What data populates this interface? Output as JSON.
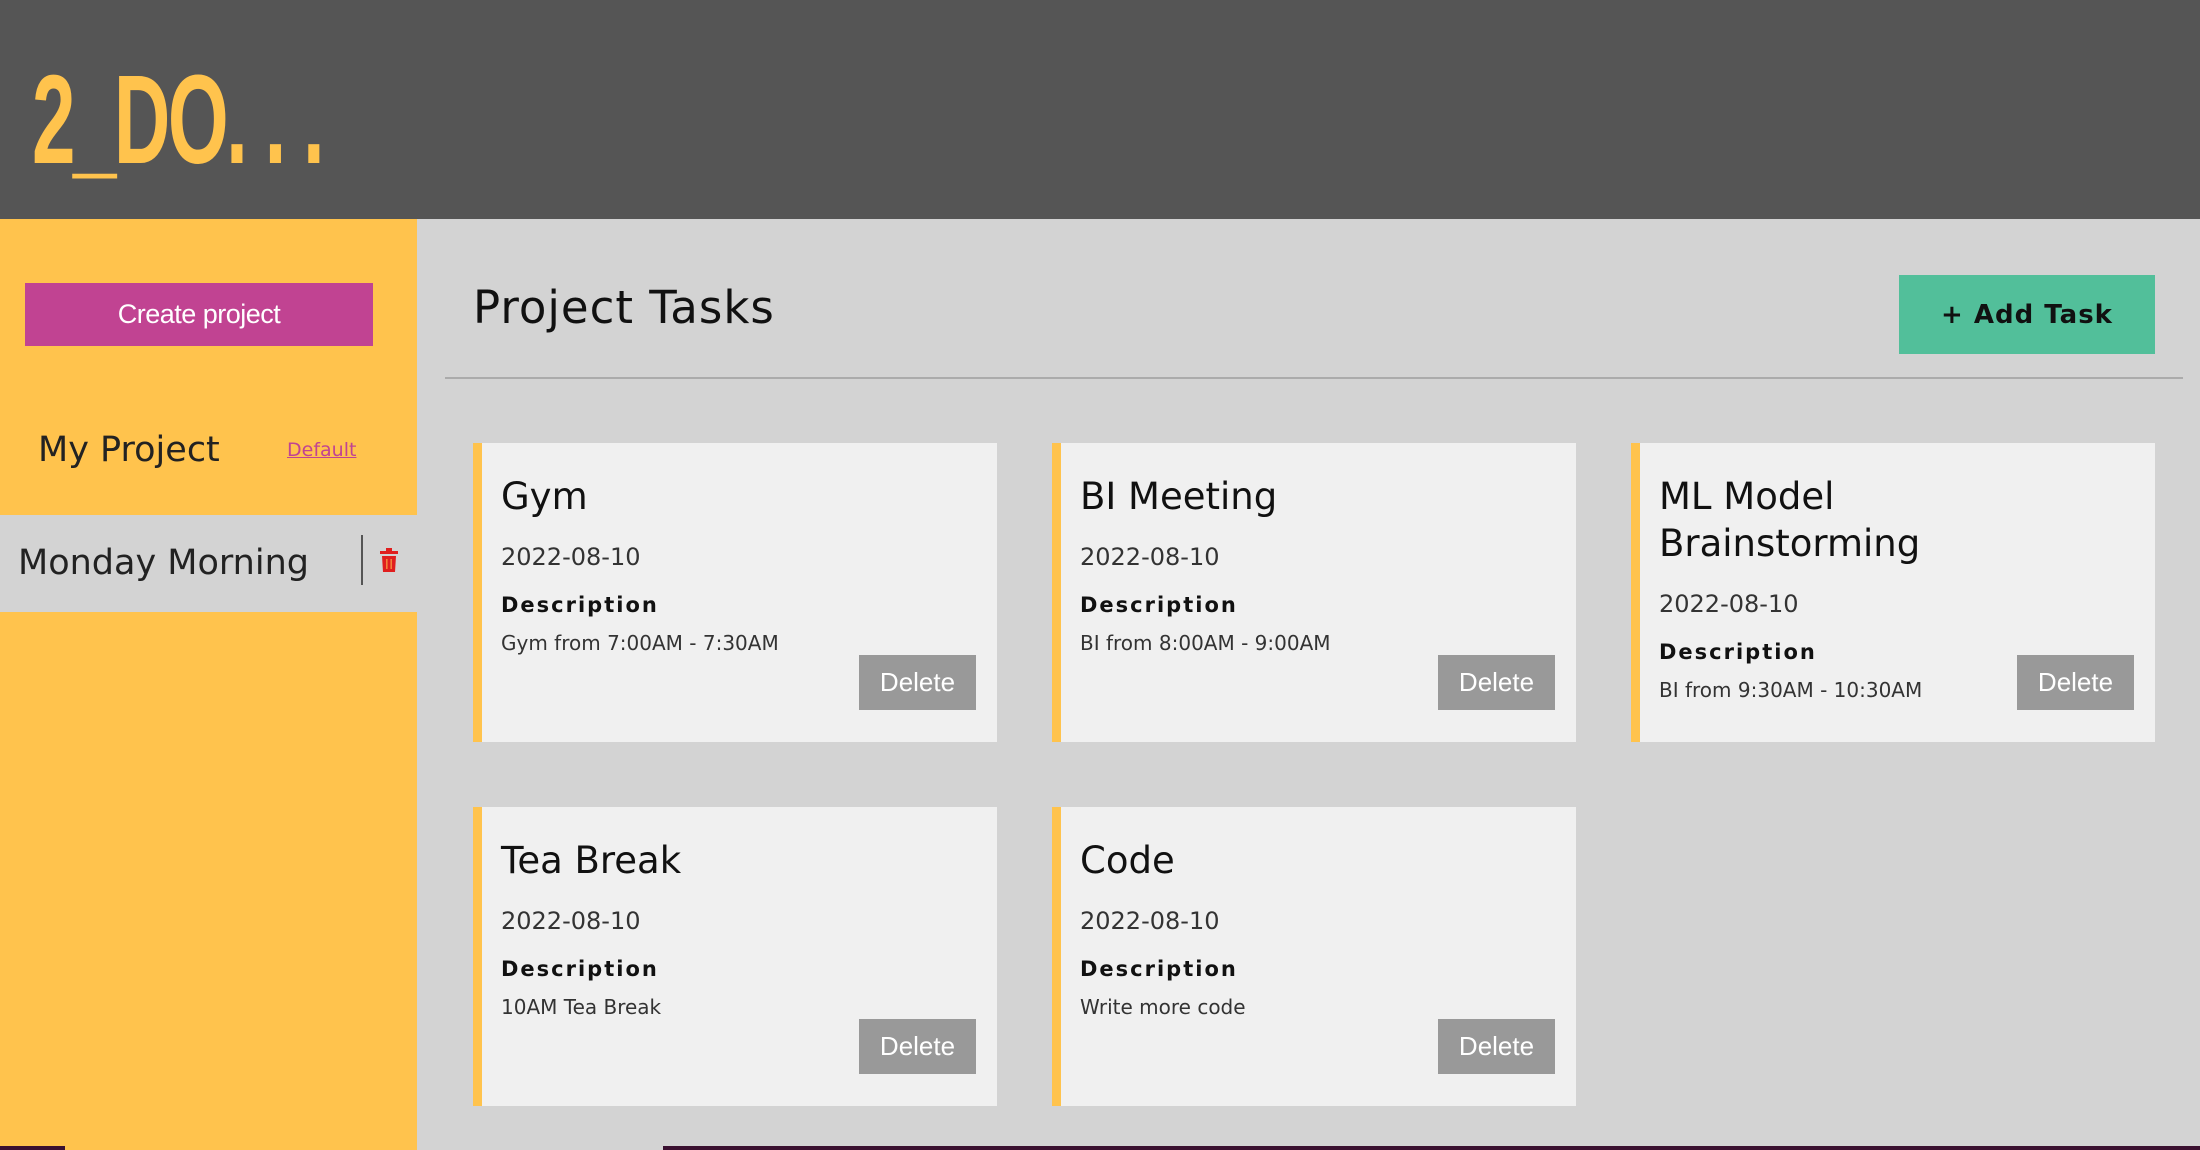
{
  "app": {
    "logo": "2_DO. . ."
  },
  "sidebar": {
    "create_button": "Create project",
    "projects": [
      {
        "name": "My Project",
        "default_label": "Default"
      },
      {
        "name": "Monday Morning"
      }
    ]
  },
  "main": {
    "title": "Project Tasks",
    "add_task_button": "+ Add Task",
    "description_label": "Description",
    "delete_label": "Delete",
    "tasks": [
      {
        "title": "Gym",
        "date": "2022-08-10",
        "description": "Gym from 7:00AM - 7:30AM"
      },
      {
        "title": "BI Meeting",
        "date": "2022-08-10",
        "description": "BI from 8:00AM - 9:00AM"
      },
      {
        "title": "ML Model Brainstorming",
        "date": "2022-08-10",
        "description": "BI from 9:30AM - 10:30AM"
      },
      {
        "title": "Tea Break",
        "date": "2022-08-10",
        "description": "10AM Tea Break"
      },
      {
        "title": "Code",
        "date": "2022-08-10",
        "description": "Write more code"
      }
    ]
  },
  "colors": {
    "header_bg": "#555555",
    "accent_yellow": "#ffc34d",
    "create_button": "#c14392",
    "add_task_button": "#52bf9a",
    "delete_button": "#999999",
    "trash_icon": "#e01e1e"
  },
  "icons": {
    "project_delete": "trash-icon"
  }
}
